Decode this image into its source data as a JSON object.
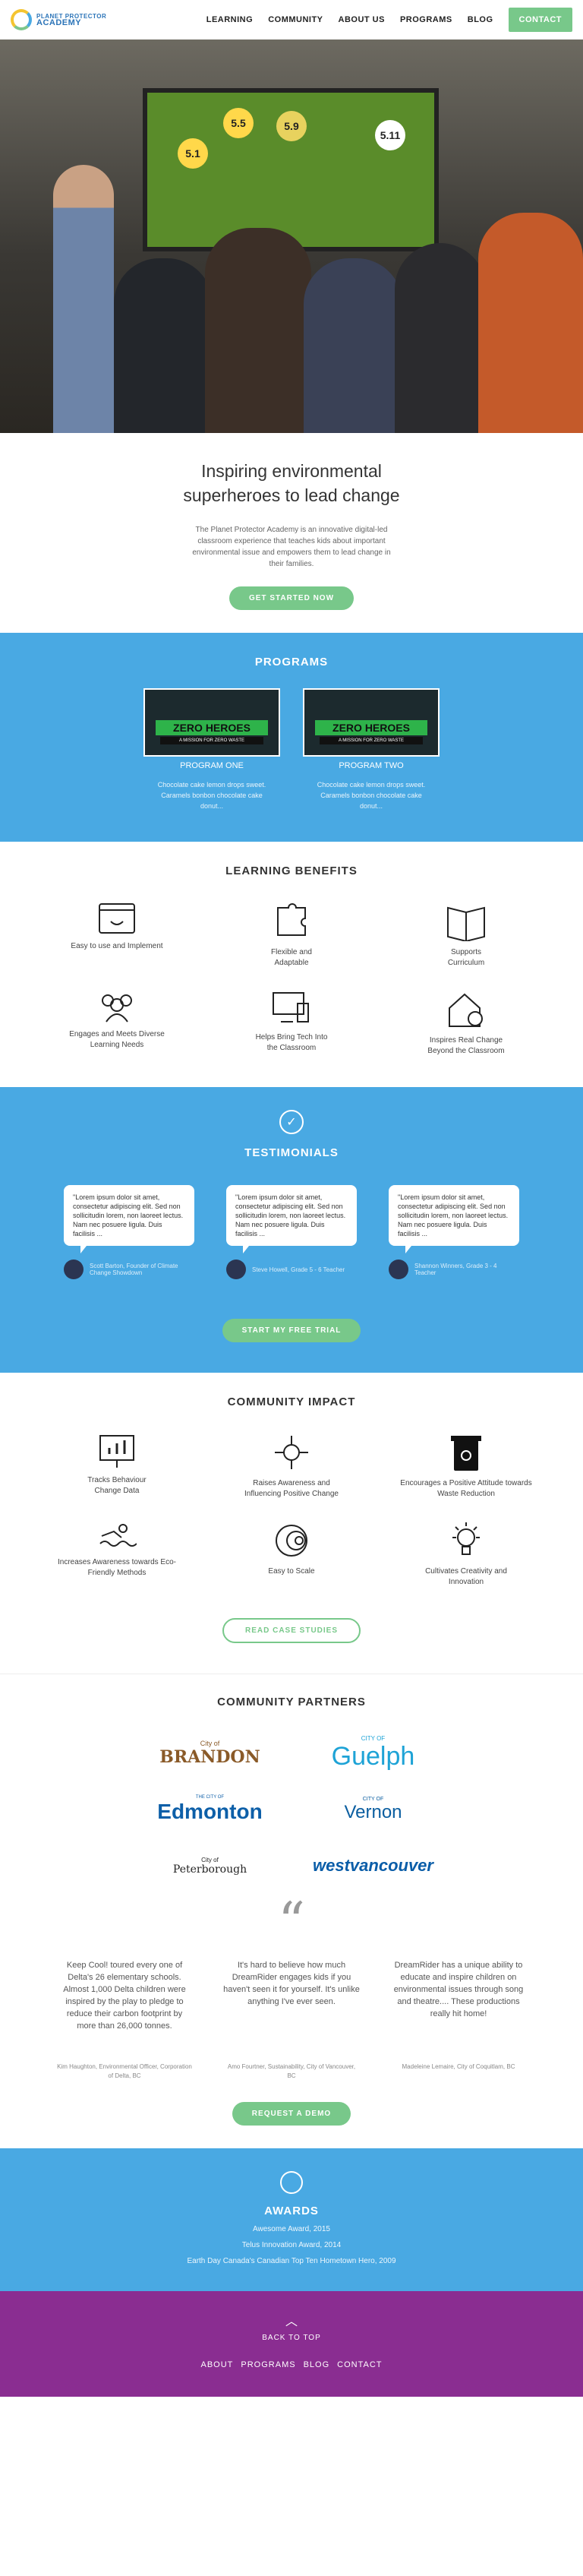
{
  "brand": {
    "name": "PLANET PROTECTOR",
    "sub": "ACADEMY"
  },
  "nav": {
    "items": [
      "LEARNING",
      "COMMUNITY",
      "ABOUT US",
      "PROGRAMS",
      "BLOG"
    ],
    "cta": "CONTACT"
  },
  "hero": {
    "tiles": [
      "5.1",
      "5.5",
      "5.9",
      "5.11"
    ]
  },
  "intro": {
    "title": "Inspiring environmental superheroes to lead change",
    "body": "The Planet Protector Academy is an innovative digital-led classroom experience that teaches kids about important environmental issue and empowers them to lead change in their families.",
    "cta": "GET STARTED NOW"
  },
  "programs": {
    "title": "PROGRAMS",
    "banner": "ZERO HEROES",
    "banner_sub": "A MISSION FOR ZERO WASTE",
    "items": [
      {
        "name": "PROGRAM ONE",
        "desc": "Chocolate cake lemon drops sweet. Caramels bonbon chocolate cake donut..."
      },
      {
        "name": "PROGRAM TWO",
        "desc": "Chocolate cake lemon drops sweet. Caramels bonbon chocolate cake donut..."
      }
    ]
  },
  "benefits": {
    "title": "LEARNING BENEFITS",
    "items": [
      "Easy to use and Implement",
      "Flexible and Adaptable",
      "Supports Curriculum",
      "Engages and Meets Diverse Learning Needs",
      "Helps Bring Tech Into the Classroom",
      "Inspires Real Change Beyond the Classroom"
    ]
  },
  "testimonials": {
    "title": "TESTIMONIALS",
    "items": [
      {
        "text": "\"Lorem ipsum dolor sit amet, consectetur adipiscing elit. Sed non sollicitudin lorem, non laoreet lectus. Nam nec posuere ligula. Duis facilisis ...",
        "author": "Scott Barton, Founder of Climate Change Showdown"
      },
      {
        "text": "\"Lorem ipsum dolor sit amet, consectetur adipiscing elit. Sed non sollicitudin lorem, non laoreet lectus. Nam nec posuere ligula. Duis facilisis ...",
        "author": "Steve Howell, Grade 5 - 6 Teacher"
      },
      {
        "text": "\"Lorem ipsum dolor sit amet, consectetur adipiscing elit. Sed non sollicitudin lorem, non laoreet lectus. Nam nec posuere ligula. Duis facilisis ...",
        "author": "Shannon Winners, Grade 3 - 4 Teacher"
      }
    ],
    "cta": "START MY FREE TRIAL"
  },
  "impact": {
    "title": "COMMUNITY IMPACT",
    "items": [
      "Tracks Behaviour Change Data",
      "Raises Awareness and Influencing Positive Change",
      "Encourages a Positive Attitude towards Waste Reduction",
      "Increases Awareness towards Eco-Friendly Methods",
      "Easy to Scale",
      "Cultivates Creativity and Innovation"
    ],
    "cta": "READ CASE STUDIES"
  },
  "partners": {
    "title": "COMMUNITY PARTNERS",
    "logos": [
      "BRANDON",
      "Guelph",
      "Edmonton",
      "Vernon",
      "Peterborough",
      "westvancouver"
    ],
    "logo_prefix": {
      "brandon": "City of",
      "guelph": "CITY OF",
      "edmonton": "THE CITY OF",
      "vernon": "CITY OF",
      "peterborough": "City of"
    },
    "quotes": [
      {
        "text": "Keep Cool! toured every one of Delta's 26 elementary schools. Almost 1,000 Delta children were inspired by the play to pledge to reduce their carbon footprint by more than 26,000 tonnes.",
        "source": "Kim Haughton, Environmental Officer, Corporation of Delta, BC"
      },
      {
        "text": "It's hard to believe how much DreamRider engages kids if you haven't seen it for yourself. It's unlike anything I've ever seen.",
        "source": "Amo Fourtner, Sustainability, City of Vancouver, BC"
      },
      {
        "text": "DreamRider has a unique ability to educate and inspire children on environmental issues through song and theatre.... These productions really hit home!",
        "source": "Madeleine Lemaire, City of Coquitlam, BC"
      }
    ],
    "cta": "REQUEST A DEMO"
  },
  "awards": {
    "title": "AWARDS",
    "items": [
      "Awesome Award, 2015",
      "Telus Innovation Award, 2014",
      "Earth Day Canada's Canadian Top Ten Hometown Hero, 2009"
    ]
  },
  "footer": {
    "back": "BACK TO TOP",
    "links": [
      "ABOUT",
      "PROGRAMS",
      "BLOG",
      "CONTACT"
    ]
  },
  "colors": {
    "blue": "#49a9e3",
    "green": "#78c88a",
    "purple": "#8a2d91"
  }
}
